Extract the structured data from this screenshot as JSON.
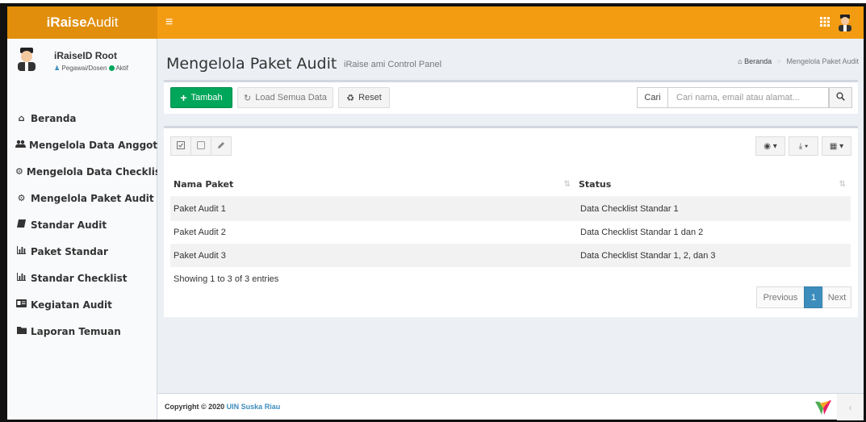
{
  "app": {
    "logo_bold": "iRaise",
    "logo_light": "Audit",
    "menu_toggle_glyph": "≡"
  },
  "user": {
    "name": "iRaiseID Root",
    "role": "Pegawai/Dosen",
    "status": "Aktif"
  },
  "sidebar": {
    "items": [
      {
        "icon": "home-icon",
        "glyph": "⌂",
        "label": "Beranda"
      },
      {
        "icon": "users-icon",
        "glyph": "👥",
        "label": "Mengelola Data Anggota"
      },
      {
        "icon": "cogs-icon",
        "glyph": "⚙",
        "label": "Mengelola Data Checklist"
      },
      {
        "icon": "cogs-icon",
        "glyph": "⚙",
        "label": "Mengelola Paket Audit"
      },
      {
        "icon": "book-icon",
        "glyph": "▰",
        "label": "Standar Audit"
      },
      {
        "icon": "bar-chart-icon",
        "glyph": "▥",
        "label": "Paket Standar"
      },
      {
        "icon": "bar-chart-icon",
        "glyph": "▥",
        "label": "Standar Checklist"
      },
      {
        "icon": "id-card-icon",
        "glyph": "▤",
        "label": "Kegiatan Audit"
      },
      {
        "icon": "folder-icon",
        "glyph": "▰",
        "label": "Laporan Temuan"
      }
    ]
  },
  "header": {
    "title": "Mengelola Paket Audit",
    "subtitle": "iRaise ami Control Panel",
    "breadcrumb": {
      "home": "Beranda",
      "current": "Mengelola Paket Audit"
    }
  },
  "toolbar": {
    "add_label": "Tambah",
    "load_label": "Load Semua Data",
    "reset_label": "Reset",
    "search_label": "Cari",
    "search_placeholder": "Cari nama, email atau alamat..."
  },
  "table": {
    "columns": [
      "Nama Paket",
      "Status"
    ],
    "rows": [
      {
        "nama": "Paket Audit 1",
        "status": "Data Checklist Standar 1"
      },
      {
        "nama": "Paket Audit 2",
        "status": "Data Checklist Standar 1 dan 2"
      },
      {
        "nama": "Paket Audit 3",
        "status": "Data Checklist Standar 1, 2, dan 3"
      }
    ],
    "info": "Showing 1 to 3 of 3 entries",
    "pagination": {
      "previous": "Previous",
      "current": "1",
      "next": "Next"
    }
  },
  "footer": {
    "copyright": "Copyright © 2020",
    "org": "UIN Suska Riau"
  },
  "colors": {
    "header_orange": "#f39c12",
    "logo_orange": "#e08e0b",
    "success_green": "#00a65a",
    "primary_blue": "#3c8dbc"
  }
}
